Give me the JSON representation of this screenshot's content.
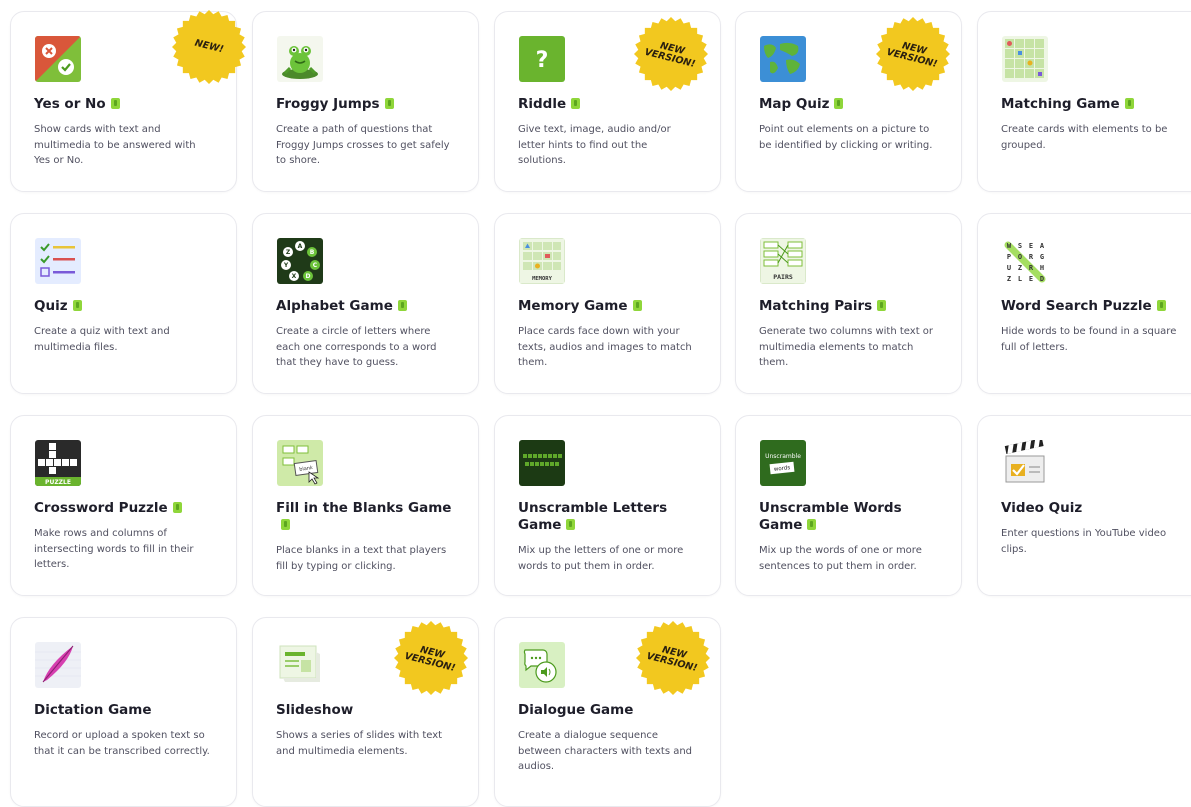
{
  "badge_color": "#f2c81f",
  "accent_green": "#8fd63a",
  "badges": {
    "new": "NEW!",
    "new_version_1": "NEW",
    "new_version_2": "VERSION!"
  },
  "cards": [
    {
      "title": "Yes or No",
      "desc": "Show cards with text and multimedia to be answered with Yes or No.",
      "icon": "yes-no-icon"
    },
    {
      "title": "Froggy Jumps",
      "desc": "Create a path of questions that Froggy Jumps crosses to get safely to shore.",
      "icon": "frog-icon"
    },
    {
      "title": "Riddle",
      "desc": "Give text, image, audio and/or letter hints to find out the solutions.",
      "icon": "question-mark-icon"
    },
    {
      "title": "Map Quiz",
      "desc": "Point out elements on a picture to be identified by clicking or writing.",
      "icon": "world-map-icon"
    },
    {
      "title": "Matching Game",
      "desc": "Create cards with elements to be grouped.",
      "icon": "matching-grid-icon"
    },
    {
      "title": "Quiz",
      "desc": "Create a quiz with text and multimedia files.",
      "icon": "checklist-icon"
    },
    {
      "title": "Alphabet Game",
      "desc": "Create a circle of letters where each one corresponds to a word that they have to guess.",
      "icon": "letter-circle-icon"
    },
    {
      "title": "Memory Game",
      "desc": "Place cards face down with your texts, audios and images to match them.",
      "icon": "memory-cards-icon"
    },
    {
      "title": "Matching Pairs",
      "desc": "Generate two columns with text or multimedia elements to match them.",
      "icon": "pairs-icon"
    },
    {
      "title": "Word Search Puzzle",
      "desc": "Hide words to be found in a square full of letters.",
      "icon": "word-search-icon"
    },
    {
      "title": "Crossword Puzzle",
      "desc": "Make rows and columns of intersecting words to fill in their letters.",
      "icon": "crossword-icon"
    },
    {
      "title": "Fill in the Blanks Game",
      "desc": "Place blanks in a text that players fill by typing or clicking.",
      "icon": "blanks-icon"
    },
    {
      "title": "Unscramble Letters Game",
      "desc": "Mix up the letters of one or more words to put them in order.",
      "icon": "unscramble-letters-icon"
    },
    {
      "title": "Unscramble Words Game",
      "desc": "Mix up the words of one or more sentences to put them in order.",
      "icon": "unscramble-words-icon"
    },
    {
      "title": "Video Quiz",
      "desc": "Enter questions in YouTube video clips.",
      "icon": "clapperboard-icon"
    },
    {
      "title": "Dictation Game",
      "desc": "Record or upload a spoken text so that it can be transcribed correctly.",
      "icon": "quill-icon"
    },
    {
      "title": "Slideshow",
      "desc": "Shows a series of slides with text and multimedia elements.",
      "icon": "slides-icon"
    },
    {
      "title": "Dialogue Game",
      "desc": "Create a dialogue sequence between characters with texts and audios.",
      "icon": "speech-bubbles-icon"
    }
  ],
  "icon_text": {
    "memory": "MEMORY",
    "pairs": "PAIRS",
    "puzzle": "PUZZLE",
    "unscramble": "Unscramble",
    "words": "words",
    "blank": "blank"
  }
}
